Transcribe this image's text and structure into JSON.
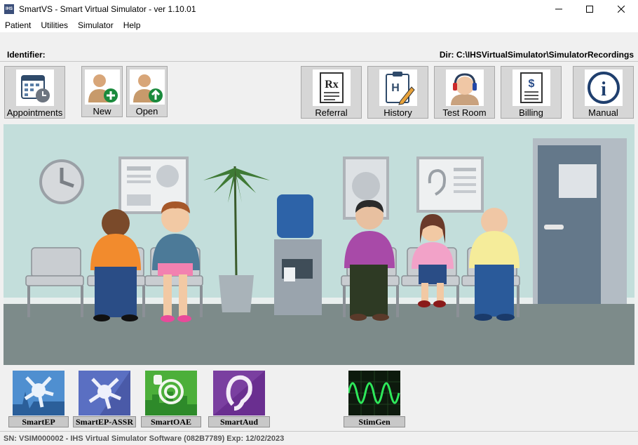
{
  "window": {
    "icon_text": "IHS",
    "title": "SmartVS - Smart Virtual Simulator - ver 1.10.01"
  },
  "menu": [
    "Patient",
    "Utilities",
    "Simulator",
    "Help"
  ],
  "identifier_label": "Identifier:",
  "dir_label": "Dir: C:\\IHSVirtualSimulator\\SimulatorRecordings",
  "toolbar": {
    "appointments": "Appointments",
    "new": "New",
    "open": "Open",
    "referral": "Referral",
    "history": "History",
    "test_room": "Test Room",
    "billing": "Billing",
    "manual": "Manual"
  },
  "icons": {
    "rx": "Rx",
    "history_letter": "H",
    "billing_symbol": "$",
    "manual_symbol": "i"
  },
  "apps": [
    "SmartEP",
    "SmartEP-ASSR",
    "SmartOAE",
    "SmartAud",
    "StimGen"
  ],
  "status": "SN: VSIM000002 - IHS Virtual Simulator Software (082B7789)   Exp: 12/02/2023"
}
